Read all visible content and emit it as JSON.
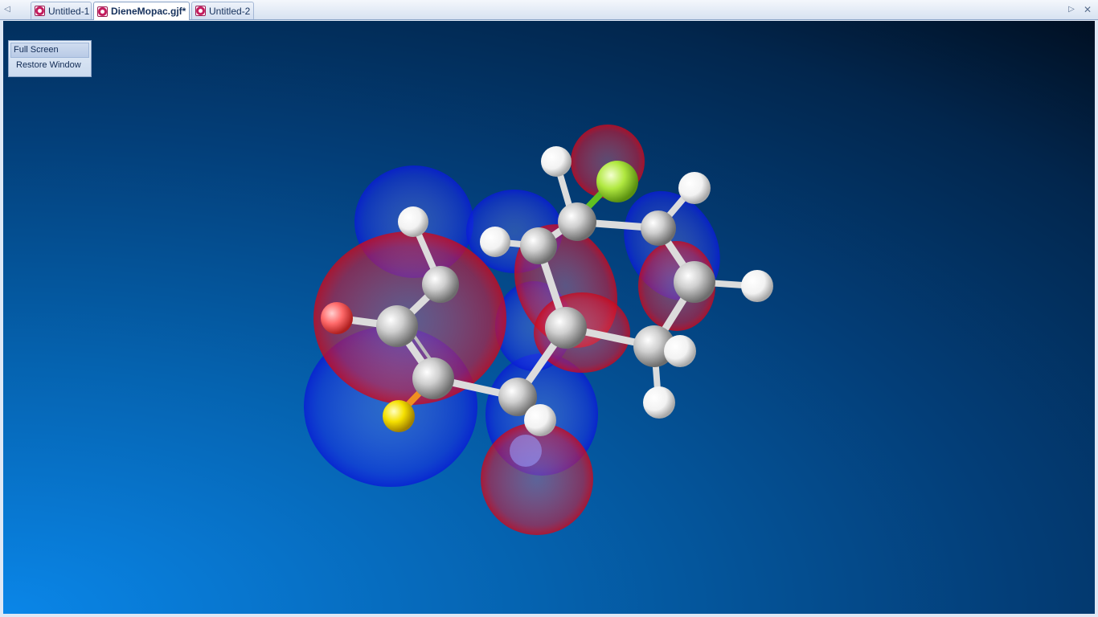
{
  "tabs": [
    {
      "label": "Untitled-1",
      "active": false
    },
    {
      "label": "DieneMopac.gjf*",
      "active": true
    },
    {
      "label": "Untitled-2",
      "active": false
    }
  ],
  "fullscreen_menu": {
    "full_screen": "Full Screen",
    "restore_window": "Restore Window"
  },
  "colors": {
    "carbon": "#c8c8c8",
    "hydrogen": "#ffffff",
    "oxygen": "#ff6060",
    "fluorine": "#a6e040",
    "sulfur": "#f0e000",
    "orbital_positive": "#d01020",
    "orbital_negative": "#1020d0"
  }
}
